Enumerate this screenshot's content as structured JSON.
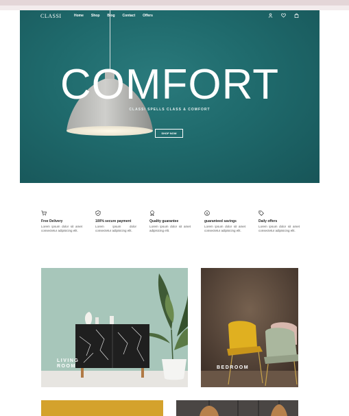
{
  "brand": {
    "logo": "CLASSI"
  },
  "nav": {
    "items": [
      {
        "label": "Home"
      },
      {
        "label": "Shop"
      },
      {
        "label": "Blog"
      },
      {
        "label": "Contact"
      },
      {
        "label": "Offers"
      }
    ],
    "icons": [
      "user-icon",
      "heart-icon",
      "bag-icon"
    ]
  },
  "hero": {
    "title": "COMFORT",
    "tagline": "CLASSI SPELLS CLASS & COMFORT",
    "cta": "SHOP NOW"
  },
  "features": [
    {
      "icon": "cart-icon",
      "title": "Free Delivery",
      "desc": "Lorem ipsum dolor sit amet consectetur adipisicing elit."
    },
    {
      "icon": "shield-icon",
      "title": "100% secure payment",
      "desc": "Lorem ipsum dolor consectetur adipisicing elit."
    },
    {
      "icon": "award-icon",
      "title": "Quality guarantee",
      "desc": "Lorem ipsum dolor sit amet adipisicing elit."
    },
    {
      "icon": "dollar-icon",
      "title": "guaranteed savings",
      "desc": "Lorem ipsum dolor sit amet consectetur adipisicing elit."
    },
    {
      "icon": "tag-icon",
      "title": "Daily offers",
      "desc": "Lorem ipsum dolor sit amet consectetur adipisicing elit."
    }
  ],
  "categories": {
    "living": "LIVING\nROOM",
    "bedroom": "BEDROOM"
  },
  "colors": {
    "hero_teal": "#1f6a6c",
    "living_bg": "#a9c7bb",
    "bedroom_bg": "#5f4c41",
    "chair_yellow": "#e0b020",
    "promo_yellow": "#d4a22c"
  }
}
